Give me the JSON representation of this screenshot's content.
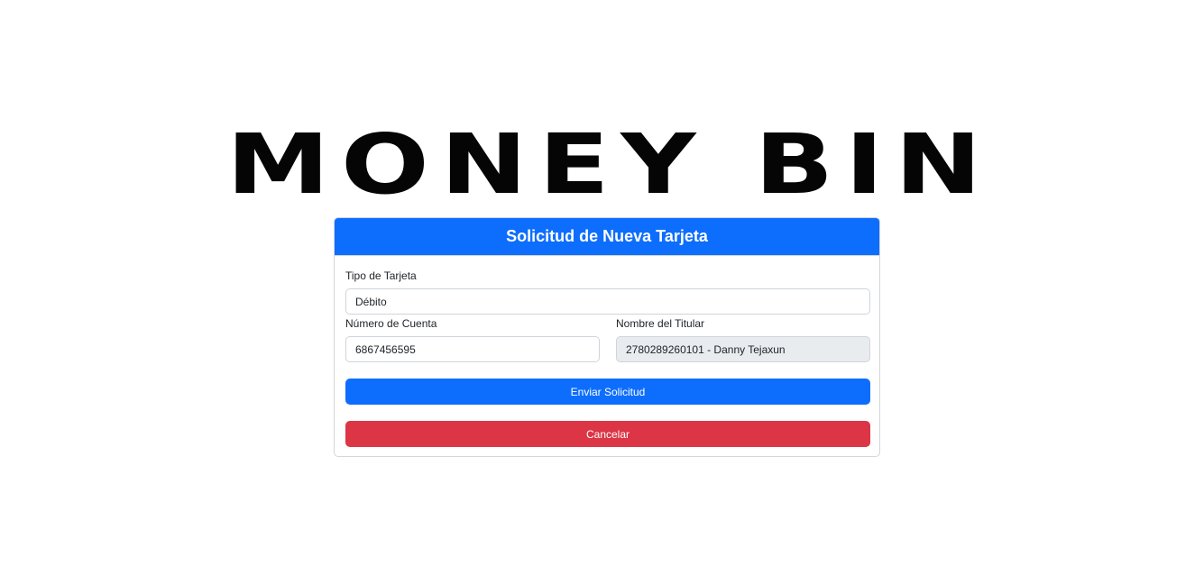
{
  "logo": {
    "text": "MONEY BIN"
  },
  "form": {
    "title": "Solicitud de Nueva Tarjeta",
    "card_type": {
      "label": "Tipo de Tarjeta",
      "value": "Débito"
    },
    "account_number": {
      "label": "Número de Cuenta",
      "value": "6867456595"
    },
    "holder_name": {
      "label": "Nombre del Titular",
      "value": "2780289260101 - Danny Tejaxun"
    },
    "submit_label": "Enviar Solicitud",
    "cancel_label": "Cancelar"
  },
  "colors": {
    "primary": "#0d6efd",
    "danger": "#dc3545",
    "readonly_bg": "#e9ecef"
  }
}
